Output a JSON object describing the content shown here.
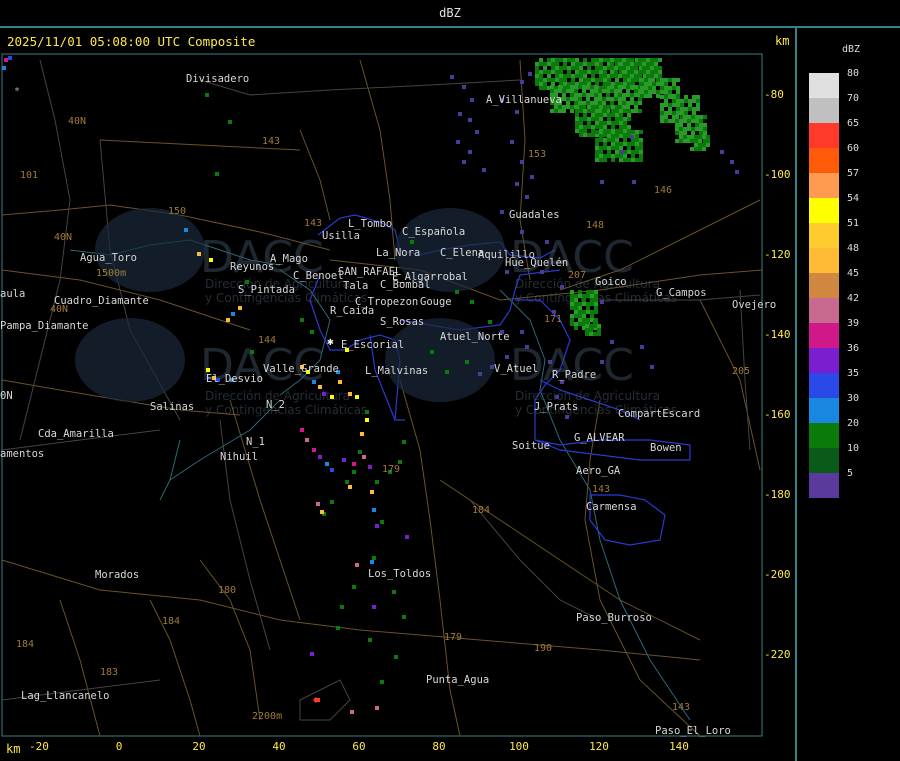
{
  "header": {
    "title": "dBZ"
  },
  "plot": {
    "subtitle": "2025/11/01 05:08:00 UTC Composite",
    "unit_top": "km",
    "unit_bottom": "km"
  },
  "x_ticks": [
    "-20",
    "0",
    "20",
    "40",
    "60",
    "80",
    "100",
    "120",
    "140"
  ],
  "y_ticks": [
    "-80",
    "-100",
    "-120",
    "-140",
    "-160",
    "-180",
    "-200",
    "-220"
  ],
  "legend": {
    "title": "dBZ",
    "levels": [
      {
        "value": "80",
        "color": "#e0e0e0"
      },
      {
        "value": "70",
        "color": "#c0c0c0"
      },
      {
        "value": "65",
        "color": "#ff3a2a"
      },
      {
        "value": "60",
        "color": "#ff5a0a"
      },
      {
        "value": "57",
        "color": "#ff9a50"
      },
      {
        "value": "54",
        "color": "#ffff00"
      },
      {
        "value": "51",
        "color": "#ffcc30"
      },
      {
        "value": "48",
        "color": "#ffbb33"
      },
      {
        "value": "45",
        "color": "#d08840"
      },
      {
        "value": "42",
        "color": "#c86a90"
      },
      {
        "value": "39",
        "color": "#d01888"
      },
      {
        "value": "36",
        "color": "#7a1ed0"
      },
      {
        "value": "35",
        "color": "#2a4ae8"
      },
      {
        "value": "30",
        "color": "#1a88e0"
      },
      {
        "value": "20",
        "color": "#0a7a0a"
      },
      {
        "value": "10",
        "color": "#0a5a1a"
      },
      {
        "value": "5",
        "color": "#5a3a9a"
      }
    ]
  },
  "places": [
    "Divisadero",
    "A_Villanueva",
    "Guadales",
    "Usilla",
    "L_Tombo",
    "C_Española",
    "La_Nora",
    "C_Elena",
    "Aquilillo",
    "Agua_Toro",
    "Reyunos",
    "A_Mago",
    "C_Benoel",
    "SAN_RAFAEL",
    "E_Algarrobal",
    "C_Bombal",
    "S_Pintada",
    "R_Caida",
    "C_Tropezon",
    "Gouge",
    "S_Rosas",
    "Atuel_Norte",
    "E_Escorial",
    "L_Malvinas",
    "V_Atuel",
    "R_Padre",
    "Valle_Grande",
    "El_Desvio",
    "Salinas",
    "N_2",
    "N_1",
    "Nihuil",
    "Cda_Amarilla",
    "J_Prats",
    "CompartEscard",
    "G_ALVEAR",
    "Bowen",
    "Soitue",
    "Aero_GA",
    "Carmensa",
    "Goico",
    "G_Campos",
    "Ovejero",
    "Pampa_Diamante",
    "Cuadro_Diamante",
    "Morados",
    "Los_Toldos",
    "Paso_Burroso",
    "Punta_Agua",
    "Lag_Llancanelo",
    "Paso_El_Loro",
    "Hue_Quelén",
    "Tala",
    "aula",
    "amentos",
    "0N"
  ],
  "route_labels": [
    "143",
    "153",
    "146",
    "150",
    "143",
    "148",
    "207",
    "171",
    "144",
    "184",
    "180",
    "179",
    "183",
    "184",
    "179",
    "190",
    "143",
    "143",
    "184",
    "40N",
    "40N",
    "40N",
    "101",
    "205"
  ],
  "elevations": [
    "1500m",
    "2200m"
  ],
  "watermark": {
    "brand": "DACC",
    "line1": "Dirección de Agricultura",
    "line2": "y Contingencias Climáticas"
  },
  "colors": {
    "accent": "#ffe84a",
    "frame": "#3a7f86",
    "boundary": "#2a3ad0",
    "roads": "#7a5a2a",
    "rivers": "#2a6a7a"
  }
}
